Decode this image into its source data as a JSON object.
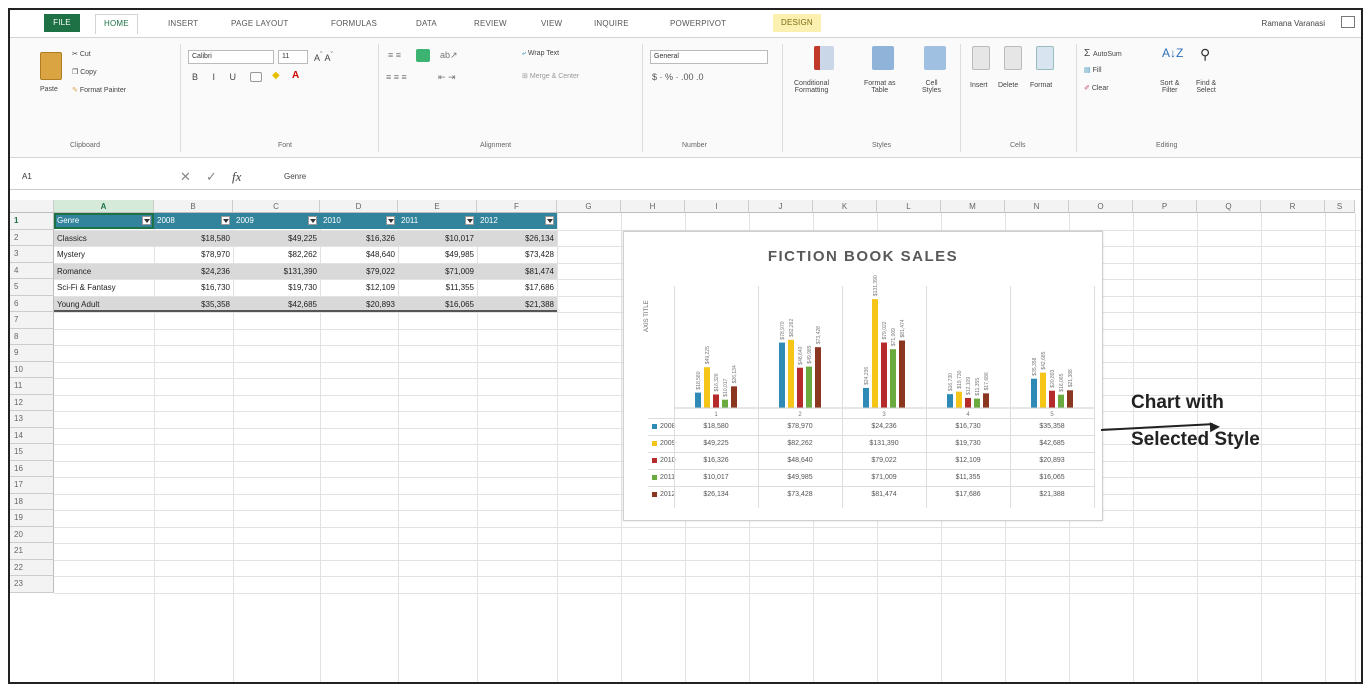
{
  "ribbon_tabs": [
    "FILE",
    "HOME",
    "INSERT",
    "PAGE LAYOUT",
    "FORMULAS",
    "DATA",
    "REVIEW",
    "VIEW",
    "INQUIRE",
    "POWERPIVOT",
    "DESIGN"
  ],
  "user_name": "Ramana Varanasi",
  "clipboard": {
    "paste": "Paste",
    "cut": "Cut",
    "copy": "Copy",
    "format_painter": "Format Painter",
    "label": "Clipboard"
  },
  "font": {
    "name": "Calibri",
    "size": "11",
    "label": "Font"
  },
  "alignment": {
    "wrap": "Wrap Text",
    "merge": "Merge & Center",
    "label": "Alignment"
  },
  "number": {
    "format": "General",
    "label": "Number"
  },
  "styles": {
    "conditional": "Conditional",
    "conditional2": "Formatting",
    "format_table": "Format as",
    "format_table2": "Table",
    "cell_styles": "Cell",
    "cell_styles2": "Styles",
    "label": "Styles"
  },
  "cells": {
    "insert": "Insert",
    "delete": "Delete",
    "format": "Format",
    "label": "Cells"
  },
  "editing": {
    "autosum": "AutoSum",
    "fill": "Fill",
    "clear": "Clear",
    "sort": "Sort &",
    "sort2": "Filter",
    "find": "Find &",
    "find2": "Select",
    "label": "Editing"
  },
  "formula_bar": {
    "name_box": "A1",
    "fx": "fx",
    "value": "Genre"
  },
  "columns": [
    "A",
    "B",
    "C",
    "D",
    "E",
    "F",
    "G",
    "H",
    "I",
    "J",
    "K",
    "L",
    "M",
    "N",
    "O",
    "P",
    "Q",
    "R",
    "S"
  ],
  "rows": [
    "1",
    "2",
    "3",
    "4",
    "5",
    "6",
    "7",
    "8",
    "9",
    "10",
    "11",
    "12",
    "13",
    "14",
    "15",
    "16",
    "17",
    "18",
    "19",
    "20",
    "21",
    "22",
    "23"
  ],
  "table": {
    "headers": [
      "Genre",
      "2008",
      "2009",
      "2010",
      "2011",
      "2012"
    ],
    "rows": [
      [
        "Classics",
        "$18,580",
        "$49,225",
        "$16,326",
        "$10,017",
        "$26,134"
      ],
      [
        "Mystery",
        "$78,970",
        "$82,262",
        "$48,640",
        "$49,985",
        "$73,428"
      ],
      [
        "Romance",
        "$24,236",
        "$131,390",
        "$79,022",
        "$71,009",
        "$81,474"
      ],
      [
        "Sci-Fi & Fantasy",
        "$16,730",
        "$19,730",
        "$12,109",
        "$11,355",
        "$17,686"
      ],
      [
        "Young Adult",
        "$35,358",
        "$42,685",
        "$20,893",
        "$16,065",
        "$21,388"
      ]
    ]
  },
  "chart_data": {
    "type": "bar",
    "title": "FICTION BOOK SALES",
    "ylabel": "AXIS TITLE",
    "categories": [
      "1",
      "2",
      "3",
      "4",
      "5"
    ],
    "series": [
      {
        "name": "2008",
        "color": "#2e8bb5",
        "values": [
          18580,
          78970,
          24236,
          16730,
          35358
        ],
        "labels": [
          "$18,580",
          "$78,970",
          "$24,236",
          "$16,730",
          "$35,358"
        ]
      },
      {
        "name": "2009",
        "color": "#f5c518",
        "values": [
          49225,
          82262,
          131390,
          19730,
          42685
        ],
        "labels": [
          "$49,225",
          "$82,262",
          "$131,390",
          "$19,730",
          "$42,685"
        ]
      },
      {
        "name": "2010",
        "color": "#b52b2b",
        "values": [
          16326,
          48640,
          79022,
          12109,
          20893
        ],
        "labels": [
          "$16,326",
          "$48,640",
          "$79,022",
          "$12,109",
          "$20,893"
        ]
      },
      {
        "name": "2011",
        "color": "#6aab3f",
        "values": [
          10017,
          49985,
          71009,
          11355,
          16065
        ],
        "labels": [
          "$10,017",
          "$49,985",
          "$71,009",
          "$11,355",
          "$16,065"
        ]
      },
      {
        "name": "2012",
        "color": "#8a3620",
        "values": [
          26134,
          73428,
          81474,
          17686,
          21388
        ],
        "labels": [
          "$26,134",
          "$73,428",
          "$81,474",
          "$17,686",
          "$21,388"
        ]
      }
    ],
    "legend": "data-table-bottom",
    "grid": false
  },
  "annotation": {
    "line1": "Chart with",
    "line2": "Selected Style"
  }
}
